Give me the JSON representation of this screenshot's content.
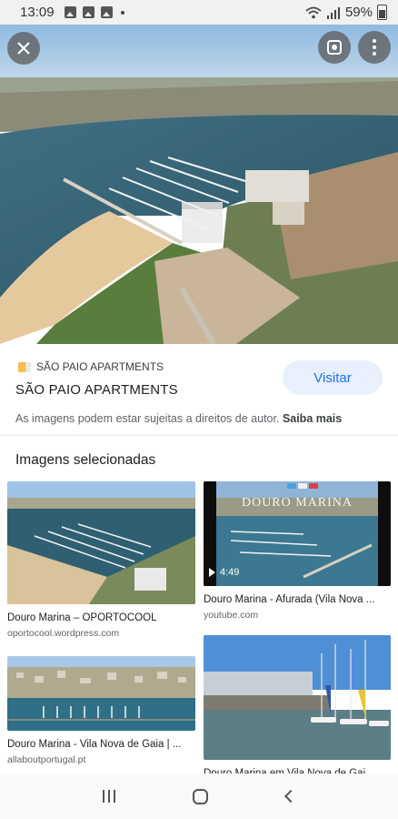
{
  "status_bar": {
    "time": "13:09",
    "battery": "59%",
    "icons": [
      "image-icon",
      "gallery-icon",
      "gallery-icon",
      "dot-icon",
      "wifi-icon",
      "signal-icon",
      "battery-icon"
    ]
  },
  "hero": {
    "alt": "aerial photo of marina"
  },
  "source": {
    "site_name": "SÃO PAIO APARTMENTS",
    "title": "SÃO PAIO APARTMENTS",
    "visit_label": "Visitar",
    "copyright_text": "As imagens podem estar sujeitas a direitos de autor.",
    "learn_more": "Saiba mais"
  },
  "related": {
    "heading": "Imagens selecionadas",
    "items": [
      {
        "title": "Douro Marina – OPORTOCOOL",
        "domain": "oportocool.wordpress.com"
      },
      {
        "title": "Douro Marina - Afurada (Vila Nova ...",
        "domain": "youtube.com",
        "duration": "4:49",
        "overlay": "DOURO MARINA"
      },
      {
        "title": "Douro Marina - Vila Nova de Gaia | ...",
        "domain": "allaboutportugal.pt"
      },
      {
        "title": "Douro Marina em Vila Nova de Gai...",
        "domain": ""
      }
    ]
  },
  "colors": {
    "accent": "#1a73e8",
    "visit_bg": "#e8f0fe"
  }
}
